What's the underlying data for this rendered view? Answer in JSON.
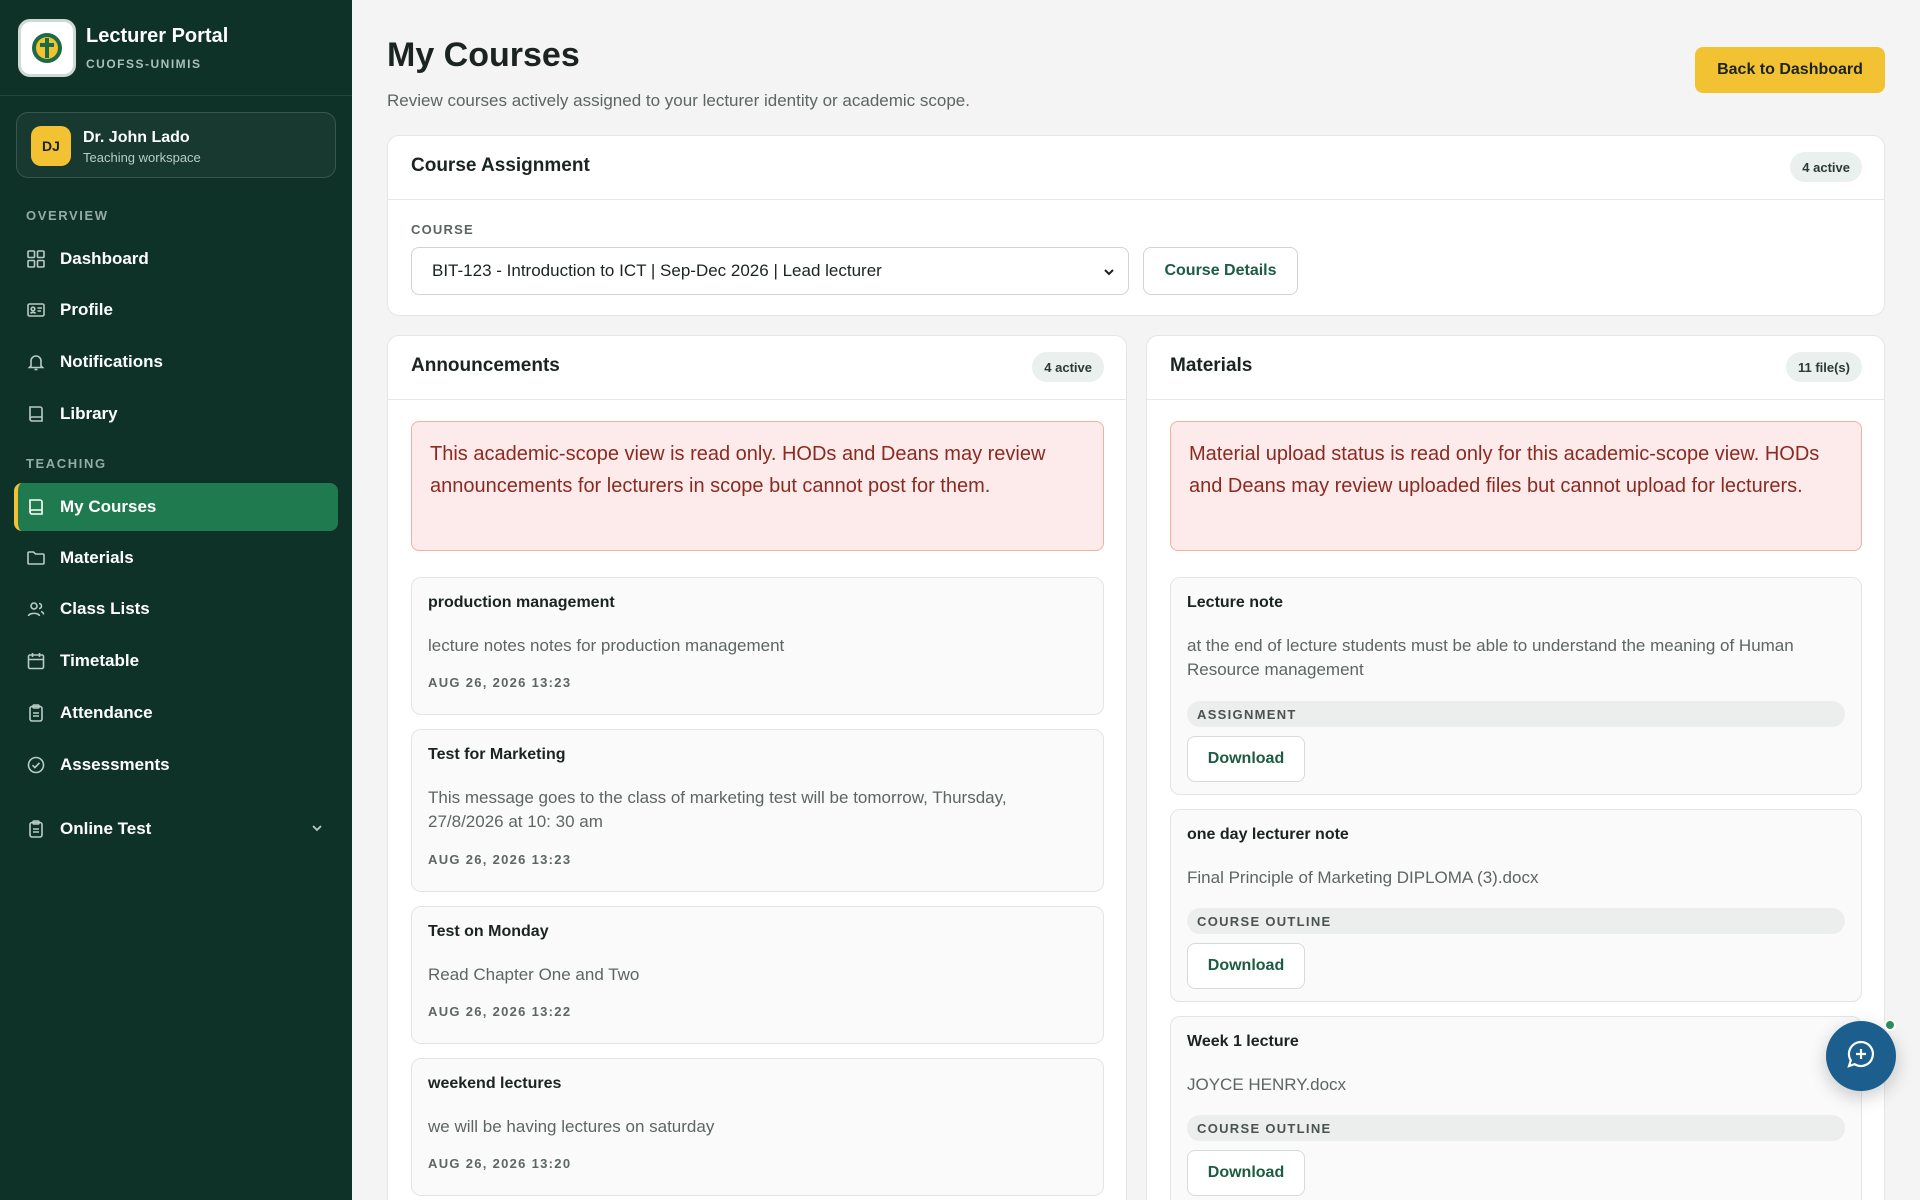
{
  "sidebar": {
    "brand_title": "Lecturer Portal",
    "brand_sub": "CUOFSS-UNIMIS",
    "user": {
      "initials": "DJ",
      "name": "Dr. John Lado",
      "role": "Teaching workspace"
    },
    "overview_label": "OVERVIEW",
    "teaching_label": "TEACHING",
    "overview_items": [
      {
        "label": "Dashboard",
        "icon": "grid-icon"
      },
      {
        "label": "Profile",
        "icon": "id-card-icon"
      },
      {
        "label": "Notifications",
        "icon": "bell-icon"
      },
      {
        "label": "Library",
        "icon": "book-icon"
      }
    ],
    "teaching_items": [
      {
        "label": "My Courses",
        "icon": "book-icon",
        "active": true
      },
      {
        "label": "Materials",
        "icon": "folder-icon"
      },
      {
        "label": "Class Lists",
        "icon": "users-icon"
      },
      {
        "label": "Timetable",
        "icon": "calendar-icon"
      },
      {
        "label": "Attendance",
        "icon": "clipboard-icon"
      },
      {
        "label": "Assessments",
        "icon": "check-circle-icon"
      },
      {
        "label": "Online Test",
        "icon": "clipboard-icon"
      }
    ]
  },
  "header": {
    "title": "My Courses",
    "subtitle": "Review courses actively assigned to your lecturer identity or academic scope.",
    "back_label": "Back to Dashboard"
  },
  "assignment": {
    "title": "Course Assignment",
    "badge": "4 active",
    "field_label": "COURSE",
    "selected_course": "BIT-123 - Introduction to ICT | Sep-Dec 2026 | Lead lecturer",
    "details_label": "Course Details"
  },
  "announcements": {
    "title": "Announcements",
    "badge": "4 active",
    "notice": "This academic-scope view is read only. HODs and Deans may review announcements for lecturers in scope but cannot post for them.",
    "items": [
      {
        "title": "production management",
        "body": "lecture notes notes for production management",
        "date": "AUG 26, 2026 13:23"
      },
      {
        "title": "Test for Marketing",
        "body": "This message goes to the class of marketing test will be tomorrow, Thursday, 27/8/2026 at 10: 30 am",
        "date": "AUG 26, 2026 13:23"
      },
      {
        "title": "Test on Monday",
        "body": "Read Chapter One and Two",
        "date": "AUG 26, 2026 13:22"
      },
      {
        "title": "weekend lectures",
        "body": "we will be having lectures on saturday",
        "date": "AUG 26, 2026 13:20"
      }
    ]
  },
  "materials": {
    "title": "Materials",
    "badge": "11 file(s)",
    "notice": "Material upload status is read only for this academic-scope view. HODs and Deans may review uploaded files but cannot upload for lecturers.",
    "download_label": "Download",
    "items": [
      {
        "title": "Lecture note",
        "body": "at the end of lecture students must be able to understand the meaning of Human Resource management",
        "tag": "ASSIGNMENT"
      },
      {
        "title": "one day lecturer note",
        "body": "Final Principle of Marketing DIPLOMA (3).docx",
        "tag": "COURSE OUTLINE"
      },
      {
        "title": "Week 1 lecture",
        "body": "JOYCE HENRY.docx",
        "tag": "COURSE OUTLINE"
      }
    ]
  },
  "colors": {
    "sidebar_bg": "#0e3128",
    "active_nav": "#1f7a4f",
    "accent": "#f2c232",
    "alert_bg": "#fdeaea",
    "alert_text": "#8a2b22",
    "fab": "#1c5f8e"
  }
}
